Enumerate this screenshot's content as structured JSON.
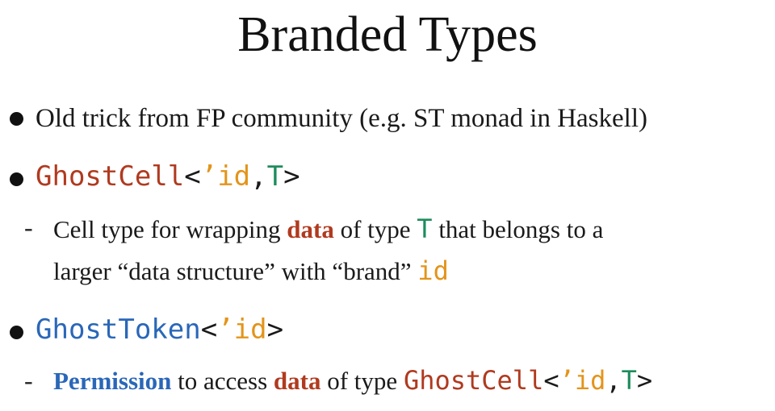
{
  "slide": {
    "title": "Branded Types",
    "bullet1": {
      "text": "Old trick from FP community (e.g. ST monad in Haskell)"
    },
    "bullet2": {
      "code_name": "GhostCell",
      "lt": "<",
      "lifetime": "’id",
      "comma": ",",
      "type_param": "T",
      "gt": ">",
      "sub": {
        "dash": "-",
        "part1": "Cell type for wrapping ",
        "emph_data": "data",
        "part2": " of type ",
        "type_param": "T",
        "part3": " that belongs to a",
        "line2_part1": "larger “data structure” with “brand” ",
        "brand_id": "id"
      }
    },
    "bullet3": {
      "code_name": "GhostToken",
      "lt": "<",
      "lifetime": "’id",
      "gt": ">",
      "sub": {
        "dash": "-",
        "emph_permission": "Permission",
        "part1": " to access ",
        "emph_data": "data",
        "part2": " of type ",
        "code_name": "GhostCell",
        "lt": "<",
        "lifetime": "’id",
        "comma": ",",
        "type_param": "T",
        "gt": ">"
      }
    }
  },
  "colors": {
    "red": "#b03a1f",
    "orange": "#e3941a",
    "green": "#1d8c5c",
    "blue": "#2a67b8",
    "text": "#1a1a1a"
  }
}
